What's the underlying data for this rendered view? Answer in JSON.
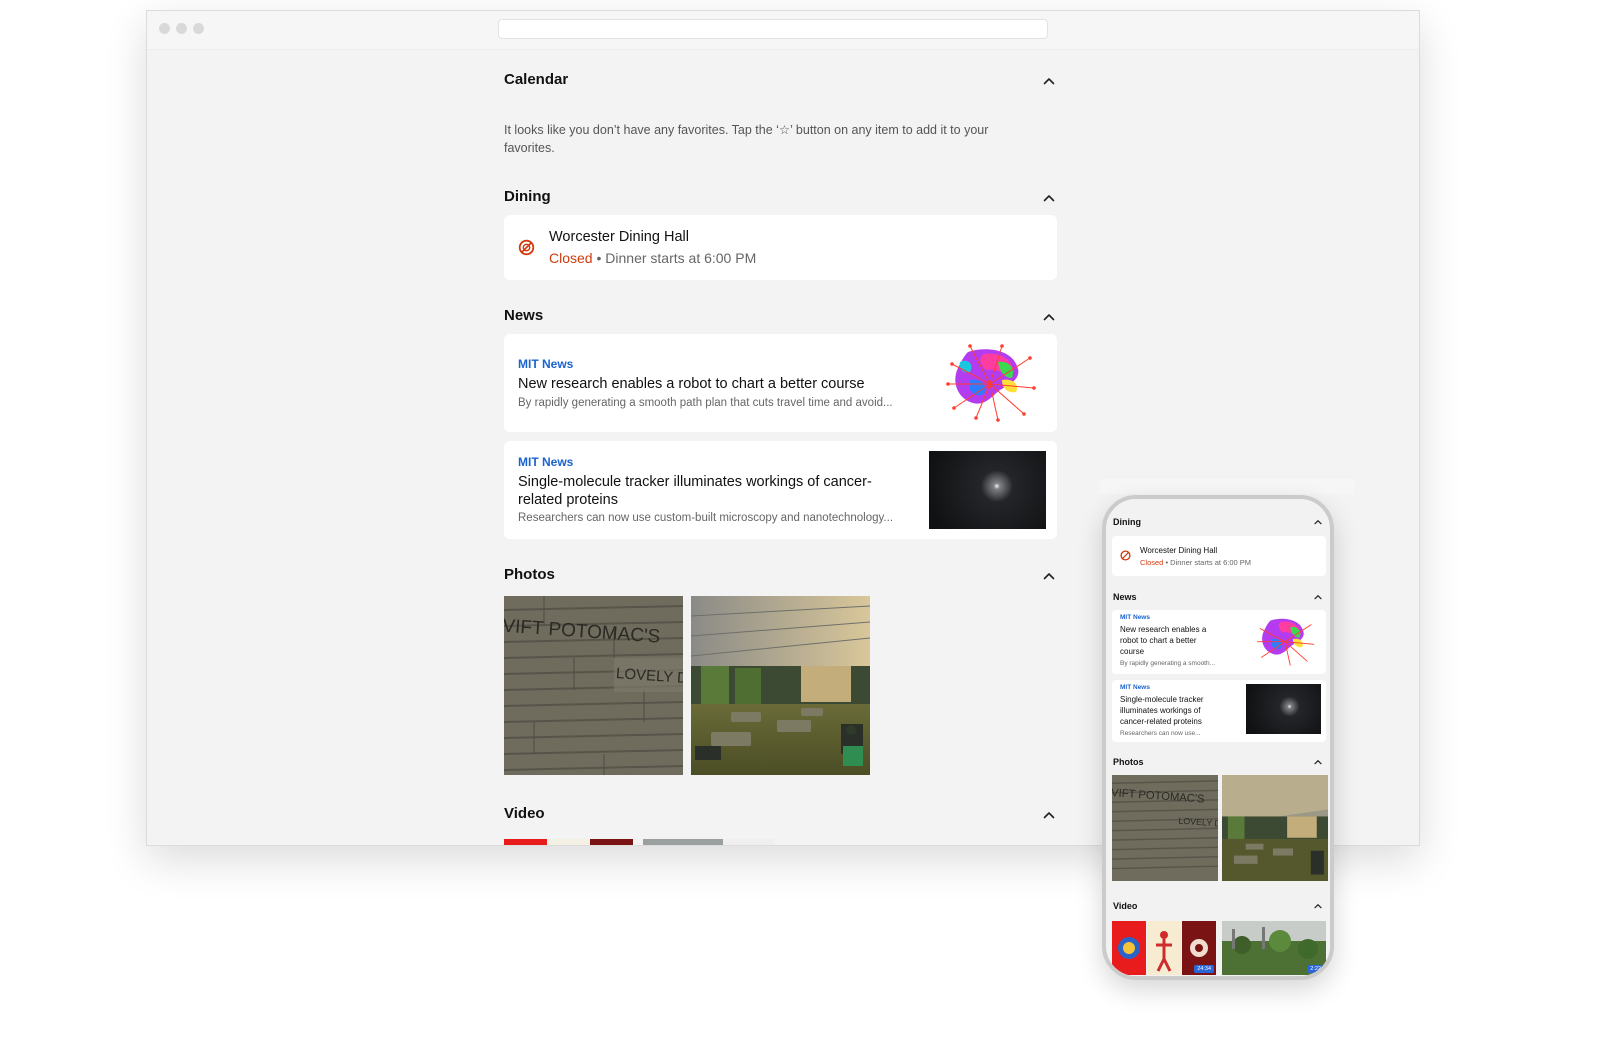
{
  "desktop": {
    "sections": {
      "calendar": {
        "title": "Calendar",
        "empty_message": "It looks like you don’t have any favorites. Tap the ‘☆’ button on any item to add it to your favorites."
      },
      "dining": {
        "title": "Dining",
        "location": "Worcester Dining Hall",
        "status": "Closed",
        "separator": " • ",
        "detail": "Dinner starts at 6:00 PM"
      },
      "news": {
        "title": "News",
        "items": [
          {
            "source": "MIT News",
            "headline": "New research enables a robot to chart a better course",
            "summary": "By rapidly generating a smooth path plan that cuts travel time and avoid..."
          },
          {
            "source": "MIT News",
            "headline": "Single-molecule tracker illuminates workings of cancer-related proteins",
            "summary": "Researchers can now use custom-built microscopy and nanotechnology..."
          }
        ]
      },
      "photos": {
        "title": "Photos",
        "wall_text_top": "VIFT POTOMAC'S",
        "wall_text_bottom": "LOVELY D"
      },
      "video": {
        "title": "Video"
      }
    }
  },
  "mobile": {
    "dining": {
      "title": "Dining",
      "location": "Worcester Dining Hall",
      "status": "Closed",
      "separator": " • ",
      "detail": "Dinner starts at 6:00 PM"
    },
    "news": {
      "title": "News",
      "items": [
        {
          "source": "MIT News",
          "headline_lines": [
            "New research enables a",
            "robot to chart a better",
            "course"
          ],
          "summary": "By rapidly generating a smooth..."
        },
        {
          "source": "MIT News",
          "headline_lines": [
            "Single-molecule tracker",
            "illuminates workings of",
            "cancer-related proteins"
          ],
          "summary": "Researchers can now use..."
        }
      ]
    },
    "photos": {
      "title": "Photos",
      "wall_text_top": "VIFT POTOMAC'S",
      "wall_text_bottom": "LOVELY D"
    },
    "video": {
      "title": "Video",
      "durations": [
        "24:34",
        "2:22"
      ]
    }
  },
  "colors": {
    "accent_blue": "#1a63d0",
    "closed_red": "#d23a0d",
    "page_bg": "#f3f3f3",
    "card_bg": "#ffffff"
  },
  "icons": {
    "collapse": "chevron-up-icon",
    "closed": "prohibited-icon",
    "window_controls": "traffic-light-dots"
  }
}
